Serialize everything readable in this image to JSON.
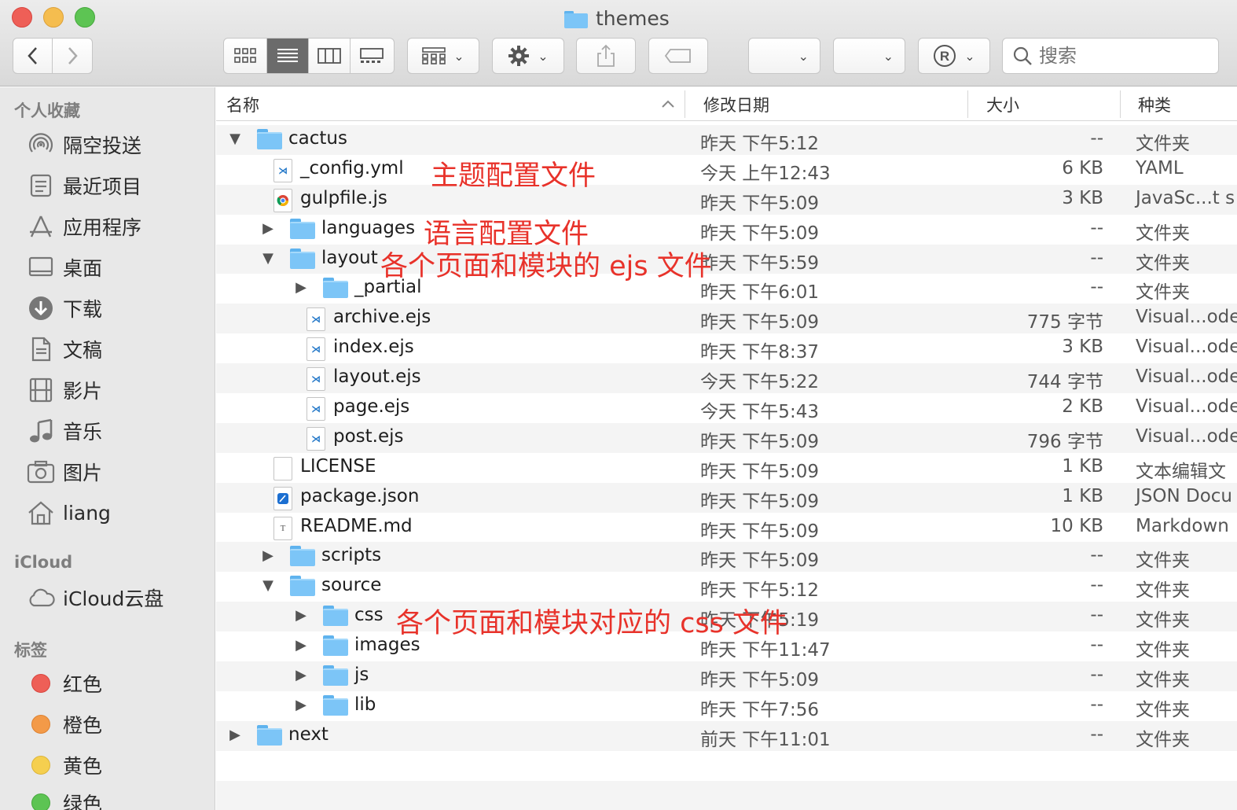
{
  "window": {
    "title": "themes"
  },
  "toolbar": {
    "search_placeholder": "搜索",
    "back": "‹",
    "forward": "›"
  },
  "sidebar": {
    "favorites_header": "个人收藏",
    "favorites": [
      {
        "label": "隔空投送",
        "icon": "airdrop-icon"
      },
      {
        "label": "最近项目",
        "icon": "recents-icon"
      },
      {
        "label": "应用程序",
        "icon": "applications-icon"
      },
      {
        "label": "桌面",
        "icon": "desktop-icon"
      },
      {
        "label": "下载",
        "icon": "downloads-icon"
      },
      {
        "label": "文稿",
        "icon": "documents-icon"
      },
      {
        "label": "影片",
        "icon": "movies-icon"
      },
      {
        "label": "音乐",
        "icon": "music-icon"
      },
      {
        "label": "图片",
        "icon": "pictures-icon"
      },
      {
        "label": "liang",
        "icon": "home-icon"
      }
    ],
    "icloud_header": "iCloud",
    "icloud": [
      {
        "label": "iCloud云盘",
        "icon": "cloud-icon"
      }
    ],
    "tags_header": "标签",
    "tags": [
      {
        "label": "红色",
        "color": "#ee5f57"
      },
      {
        "label": "橙色",
        "color": "#f39a48"
      },
      {
        "label": "黄色",
        "color": "#f5cf4f"
      },
      {
        "label": "绿色",
        "color": "#5dc453"
      }
    ]
  },
  "columns": {
    "name": "名称",
    "date": "修改日期",
    "size": "大小",
    "kind": "种类"
  },
  "rows": [
    {
      "depth": 0,
      "disclosure": "open",
      "type": "folder",
      "name": "cactus",
      "date": "昨天 下午5:12",
      "size": "--",
      "kind": "文件夹"
    },
    {
      "depth": 1,
      "disclosure": "none",
      "type": "vscode",
      "name": "_config.yml",
      "date": "今天 上午12:43",
      "size": "6 KB",
      "kind": "YAML"
    },
    {
      "depth": 1,
      "disclosure": "none",
      "type": "chrome",
      "name": "gulpfile.js",
      "date": "昨天 下午5:09",
      "size": "3 KB",
      "kind": "JavaSc...t s"
    },
    {
      "depth": 1,
      "disclosure": "closed",
      "type": "folder",
      "name": "languages",
      "date": "昨天 下午5:09",
      "size": "--",
      "kind": "文件夹"
    },
    {
      "depth": 1,
      "disclosure": "open",
      "type": "folder",
      "name": "layout",
      "date": "昨天 下午5:59",
      "size": "--",
      "kind": "文件夹"
    },
    {
      "depth": 2,
      "disclosure": "closed",
      "type": "folder",
      "name": "_partial",
      "date": "昨天 下午6:01",
      "size": "--",
      "kind": "文件夹"
    },
    {
      "depth": 2,
      "disclosure": "none",
      "type": "vscode",
      "name": "archive.ejs",
      "date": "昨天 下午5:09",
      "size": "775 字节",
      "kind": "Visual...ode"
    },
    {
      "depth": 2,
      "disclosure": "none",
      "type": "vscode",
      "name": "index.ejs",
      "date": "昨天 下午8:37",
      "size": "3 KB",
      "kind": "Visual...ode"
    },
    {
      "depth": 2,
      "disclosure": "none",
      "type": "vscode",
      "name": "layout.ejs",
      "date": "今天 下午5:22",
      "size": "744 字节",
      "kind": "Visual...ode"
    },
    {
      "depth": 2,
      "disclosure": "none",
      "type": "vscode",
      "name": "page.ejs",
      "date": "今天 下午5:43",
      "size": "2 KB",
      "kind": "Visual...ode"
    },
    {
      "depth": 2,
      "disclosure": "none",
      "type": "vscode",
      "name": "post.ejs",
      "date": "昨天 下午5:09",
      "size": "796 字节",
      "kind": "Visual...ode"
    },
    {
      "depth": 1,
      "disclosure": "none",
      "type": "text",
      "name": "LICENSE",
      "date": "昨天 下午5:09",
      "size": "1 KB",
      "kind": "文本编辑文"
    },
    {
      "depth": 1,
      "disclosure": "none",
      "type": "json",
      "name": "package.json",
      "date": "昨天 下午5:09",
      "size": "1 KB",
      "kind": "JSON Docu"
    },
    {
      "depth": 1,
      "disclosure": "none",
      "type": "markdown",
      "name": "README.md",
      "date": "昨天 下午5:09",
      "size": "10 KB",
      "kind": "Markdown"
    },
    {
      "depth": 1,
      "disclosure": "closed",
      "type": "folder",
      "name": "scripts",
      "date": "昨天 下午5:09",
      "size": "--",
      "kind": "文件夹"
    },
    {
      "depth": 1,
      "disclosure": "open",
      "type": "folder",
      "name": "source",
      "date": "昨天 下午5:12",
      "size": "--",
      "kind": "文件夹"
    },
    {
      "depth": 2,
      "disclosure": "closed",
      "type": "folder",
      "name": "css",
      "date": "昨天 下午5:19",
      "size": "--",
      "kind": "文件夹"
    },
    {
      "depth": 2,
      "disclosure": "closed",
      "type": "folder",
      "name": "images",
      "date": "昨天 下午11:47",
      "size": "--",
      "kind": "文件夹"
    },
    {
      "depth": 2,
      "disclosure": "closed",
      "type": "folder",
      "name": "js",
      "date": "昨天 下午5:09",
      "size": "--",
      "kind": "文件夹"
    },
    {
      "depth": 2,
      "disclosure": "closed",
      "type": "folder",
      "name": "lib",
      "date": "昨天 下午7:56",
      "size": "--",
      "kind": "文件夹"
    },
    {
      "depth": 0,
      "disclosure": "closed",
      "type": "folder",
      "name": "next",
      "date": "前天 下午11:01",
      "size": "--",
      "kind": "文件夹"
    }
  ],
  "annotations": [
    {
      "text": "主题配置文件"
    },
    {
      "text": "语言配置文件"
    },
    {
      "text": "各个页面和模块的 ejs 文件"
    },
    {
      "text": "各个页面和模块对应的 css 文件"
    }
  ],
  "colors": {
    "annotation": "#e8322a",
    "folder": "#7cc5f7"
  }
}
